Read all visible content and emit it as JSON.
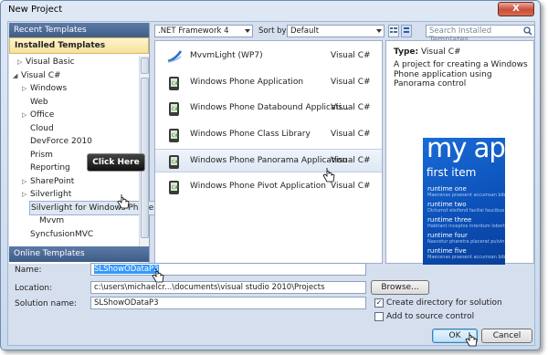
{
  "window": {
    "title": "New Project",
    "close_label": "X"
  },
  "left": {
    "recent_label": "Recent Templates",
    "installed_label": "Installed Templates",
    "online_label": "Online Templates",
    "tree": [
      {
        "label": "Visual Basic",
        "indent": 1,
        "arrow": "▷"
      },
      {
        "label": "Visual C#",
        "indent": 0,
        "arrow": "◢"
      },
      {
        "label": "Windows",
        "indent": 2,
        "arrow": "▷"
      },
      {
        "label": "Web",
        "indent": 2,
        "arrow": ""
      },
      {
        "label": "Office",
        "indent": 2,
        "arrow": "▷"
      },
      {
        "label": "Cloud",
        "indent": 2,
        "arrow": ""
      },
      {
        "label": "DevForce 2010",
        "indent": 2,
        "arrow": ""
      },
      {
        "label": "Prism",
        "indent": 2,
        "arrow": ""
      },
      {
        "label": "Reporting",
        "indent": 2,
        "arrow": ""
      },
      {
        "label": "SharePoint",
        "indent": 2,
        "arrow": "▷"
      },
      {
        "label": "Silverlight",
        "indent": 2,
        "arrow": "▷"
      },
      {
        "label": "Silverlight for Windows Phone",
        "indent": 2,
        "arrow": ""
      },
      {
        "label": "Mvvm",
        "indent": 3,
        "arrow": ""
      },
      {
        "label": "SyncfusionMVC",
        "indent": 2,
        "arrow": ""
      }
    ],
    "tooltip": "Click Here"
  },
  "toolbar": {
    "framework": ".NET Framework 4",
    "sort_by_label": "Sort by:",
    "sort_value": "Default",
    "search_placeholder": "Search Installed Templates"
  },
  "templates": [
    {
      "name": "MvvmLight (WP7)",
      "lang": "Visual C#"
    },
    {
      "name": "Windows Phone Application",
      "lang": "Visual C#"
    },
    {
      "name": "Windows Phone Databound Applicati...",
      "lang": "Visual C#"
    },
    {
      "name": "Windows Phone Class Library",
      "lang": "Visual C#"
    },
    {
      "name": "Windows Phone Panorama Application",
      "lang": "Visual C#"
    },
    {
      "name": "Windows Phone Pivot Application",
      "lang": "Visual C#"
    }
  ],
  "details": {
    "type_label": "Type:",
    "type_value": "Visual C#",
    "description": "A project for creating a Windows Phone application using Panorama control",
    "preview": {
      "title": "my ap",
      "subtitle": "first item",
      "items": [
        {
          "main": "runtime one",
          "sub": "Maecenas praesent accumsan bibendum"
        },
        {
          "main": "runtime two",
          "sub": "Dictumst eleifend facilisi faucibus"
        },
        {
          "main": "runtime three",
          "sub": "Habitant inceptos interdum lobortis"
        },
        {
          "main": "runtime four",
          "sub": "Nascetur pharetra placerat pulvinar"
        },
        {
          "main": "runtime five",
          "sub": "Maecenas praesent accumsan bibendum"
        }
      ]
    }
  },
  "form": {
    "name_label": "Name:",
    "name_value": "SLShowODataP3",
    "location_label": "Location:",
    "location_value": "c:\\users\\michaelcr...\\documents\\visual studio 2010\\Projects",
    "solution_label": "Solution name:",
    "solution_value": "SLShowODataP3",
    "browse_label": "Browse...",
    "create_dir_label": "Create directory for solution",
    "create_dir_checked": "✓",
    "add_source_label": "Add to source control",
    "ok_label": "OK",
    "cancel_label": "Cancel"
  }
}
